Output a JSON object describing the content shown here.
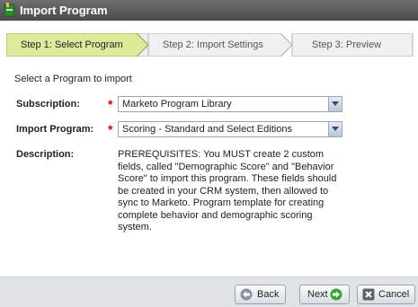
{
  "window": {
    "title": "Import Program"
  },
  "steps": [
    {
      "label": "Step 1: Select Program",
      "active": true
    },
    {
      "label": "Step 2: Import Settings",
      "active": false
    },
    {
      "label": "Step 3: Preview",
      "active": false
    }
  ],
  "form": {
    "intro": "Select a Program to import",
    "subscription": {
      "label": "Subscription:",
      "value": "Marketo Program Library"
    },
    "import_program": {
      "label": "Import Program:",
      "value": "Scoring - Standard and Select Editions"
    },
    "description": {
      "label": "Description:",
      "text": "PREREQUISITES: You MUST create 2 custom fields, called \"Demographic Score\" and \"Behavior Score\" to import this program. These fields should be created in your CRM system, then allowed to sync to Marketo. Program template for creating complete behavior and demographic scoring system."
    }
  },
  "footer": {
    "back_label": "Back",
    "next_label": "Next",
    "cancel_label": "Cancel"
  },
  "colors": {
    "active_step": "#dfe99a",
    "required": "#cc0000",
    "next_icon": "#3aa33a"
  }
}
